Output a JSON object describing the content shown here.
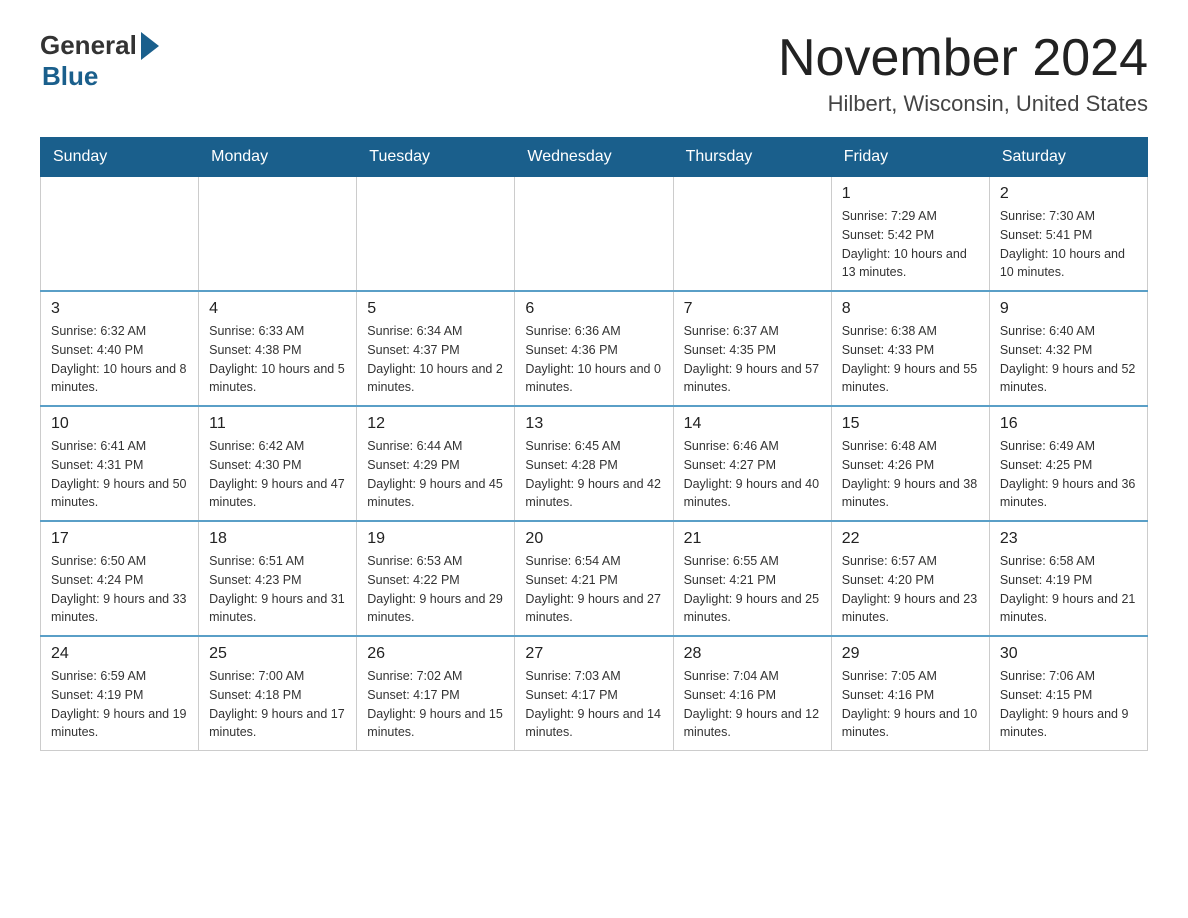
{
  "logo": {
    "general": "General",
    "arrow": "▶",
    "blue": "Blue"
  },
  "title": "November 2024",
  "subtitle": "Hilbert, Wisconsin, United States",
  "days_of_week": [
    "Sunday",
    "Monday",
    "Tuesday",
    "Wednesday",
    "Thursday",
    "Friday",
    "Saturday"
  ],
  "weeks": [
    [
      {
        "day": "",
        "sunrise": "",
        "sunset": "",
        "daylight": "",
        "empty": true
      },
      {
        "day": "",
        "sunrise": "",
        "sunset": "",
        "daylight": "",
        "empty": true
      },
      {
        "day": "",
        "sunrise": "",
        "sunset": "",
        "daylight": "",
        "empty": true
      },
      {
        "day": "",
        "sunrise": "",
        "sunset": "",
        "daylight": "",
        "empty": true
      },
      {
        "day": "",
        "sunrise": "",
        "sunset": "",
        "daylight": "",
        "empty": true
      },
      {
        "day": "1",
        "sunrise": "Sunrise: 7:29 AM",
        "sunset": "Sunset: 5:42 PM",
        "daylight": "Daylight: 10 hours and 13 minutes.",
        "empty": false
      },
      {
        "day": "2",
        "sunrise": "Sunrise: 7:30 AM",
        "sunset": "Sunset: 5:41 PM",
        "daylight": "Daylight: 10 hours and 10 minutes.",
        "empty": false
      }
    ],
    [
      {
        "day": "3",
        "sunrise": "Sunrise: 6:32 AM",
        "sunset": "Sunset: 4:40 PM",
        "daylight": "Daylight: 10 hours and 8 minutes.",
        "empty": false
      },
      {
        "day": "4",
        "sunrise": "Sunrise: 6:33 AM",
        "sunset": "Sunset: 4:38 PM",
        "daylight": "Daylight: 10 hours and 5 minutes.",
        "empty": false
      },
      {
        "day": "5",
        "sunrise": "Sunrise: 6:34 AM",
        "sunset": "Sunset: 4:37 PM",
        "daylight": "Daylight: 10 hours and 2 minutes.",
        "empty": false
      },
      {
        "day": "6",
        "sunrise": "Sunrise: 6:36 AM",
        "sunset": "Sunset: 4:36 PM",
        "daylight": "Daylight: 10 hours and 0 minutes.",
        "empty": false
      },
      {
        "day": "7",
        "sunrise": "Sunrise: 6:37 AM",
        "sunset": "Sunset: 4:35 PM",
        "daylight": "Daylight: 9 hours and 57 minutes.",
        "empty": false
      },
      {
        "day": "8",
        "sunrise": "Sunrise: 6:38 AM",
        "sunset": "Sunset: 4:33 PM",
        "daylight": "Daylight: 9 hours and 55 minutes.",
        "empty": false
      },
      {
        "day": "9",
        "sunrise": "Sunrise: 6:40 AM",
        "sunset": "Sunset: 4:32 PM",
        "daylight": "Daylight: 9 hours and 52 minutes.",
        "empty": false
      }
    ],
    [
      {
        "day": "10",
        "sunrise": "Sunrise: 6:41 AM",
        "sunset": "Sunset: 4:31 PM",
        "daylight": "Daylight: 9 hours and 50 minutes.",
        "empty": false
      },
      {
        "day": "11",
        "sunrise": "Sunrise: 6:42 AM",
        "sunset": "Sunset: 4:30 PM",
        "daylight": "Daylight: 9 hours and 47 minutes.",
        "empty": false
      },
      {
        "day": "12",
        "sunrise": "Sunrise: 6:44 AM",
        "sunset": "Sunset: 4:29 PM",
        "daylight": "Daylight: 9 hours and 45 minutes.",
        "empty": false
      },
      {
        "day": "13",
        "sunrise": "Sunrise: 6:45 AM",
        "sunset": "Sunset: 4:28 PM",
        "daylight": "Daylight: 9 hours and 42 minutes.",
        "empty": false
      },
      {
        "day": "14",
        "sunrise": "Sunrise: 6:46 AM",
        "sunset": "Sunset: 4:27 PM",
        "daylight": "Daylight: 9 hours and 40 minutes.",
        "empty": false
      },
      {
        "day": "15",
        "sunrise": "Sunrise: 6:48 AM",
        "sunset": "Sunset: 4:26 PM",
        "daylight": "Daylight: 9 hours and 38 minutes.",
        "empty": false
      },
      {
        "day": "16",
        "sunrise": "Sunrise: 6:49 AM",
        "sunset": "Sunset: 4:25 PM",
        "daylight": "Daylight: 9 hours and 36 minutes.",
        "empty": false
      }
    ],
    [
      {
        "day": "17",
        "sunrise": "Sunrise: 6:50 AM",
        "sunset": "Sunset: 4:24 PM",
        "daylight": "Daylight: 9 hours and 33 minutes.",
        "empty": false
      },
      {
        "day": "18",
        "sunrise": "Sunrise: 6:51 AM",
        "sunset": "Sunset: 4:23 PM",
        "daylight": "Daylight: 9 hours and 31 minutes.",
        "empty": false
      },
      {
        "day": "19",
        "sunrise": "Sunrise: 6:53 AM",
        "sunset": "Sunset: 4:22 PM",
        "daylight": "Daylight: 9 hours and 29 minutes.",
        "empty": false
      },
      {
        "day": "20",
        "sunrise": "Sunrise: 6:54 AM",
        "sunset": "Sunset: 4:21 PM",
        "daylight": "Daylight: 9 hours and 27 minutes.",
        "empty": false
      },
      {
        "day": "21",
        "sunrise": "Sunrise: 6:55 AM",
        "sunset": "Sunset: 4:21 PM",
        "daylight": "Daylight: 9 hours and 25 minutes.",
        "empty": false
      },
      {
        "day": "22",
        "sunrise": "Sunrise: 6:57 AM",
        "sunset": "Sunset: 4:20 PM",
        "daylight": "Daylight: 9 hours and 23 minutes.",
        "empty": false
      },
      {
        "day": "23",
        "sunrise": "Sunrise: 6:58 AM",
        "sunset": "Sunset: 4:19 PM",
        "daylight": "Daylight: 9 hours and 21 minutes.",
        "empty": false
      }
    ],
    [
      {
        "day": "24",
        "sunrise": "Sunrise: 6:59 AM",
        "sunset": "Sunset: 4:19 PM",
        "daylight": "Daylight: 9 hours and 19 minutes.",
        "empty": false
      },
      {
        "day": "25",
        "sunrise": "Sunrise: 7:00 AM",
        "sunset": "Sunset: 4:18 PM",
        "daylight": "Daylight: 9 hours and 17 minutes.",
        "empty": false
      },
      {
        "day": "26",
        "sunrise": "Sunrise: 7:02 AM",
        "sunset": "Sunset: 4:17 PM",
        "daylight": "Daylight: 9 hours and 15 minutes.",
        "empty": false
      },
      {
        "day": "27",
        "sunrise": "Sunrise: 7:03 AM",
        "sunset": "Sunset: 4:17 PM",
        "daylight": "Daylight: 9 hours and 14 minutes.",
        "empty": false
      },
      {
        "day": "28",
        "sunrise": "Sunrise: 7:04 AM",
        "sunset": "Sunset: 4:16 PM",
        "daylight": "Daylight: 9 hours and 12 minutes.",
        "empty": false
      },
      {
        "day": "29",
        "sunrise": "Sunrise: 7:05 AM",
        "sunset": "Sunset: 4:16 PM",
        "daylight": "Daylight: 9 hours and 10 minutes.",
        "empty": false
      },
      {
        "day": "30",
        "sunrise": "Sunrise: 7:06 AM",
        "sunset": "Sunset: 4:15 PM",
        "daylight": "Daylight: 9 hours and 9 minutes.",
        "empty": false
      }
    ]
  ]
}
